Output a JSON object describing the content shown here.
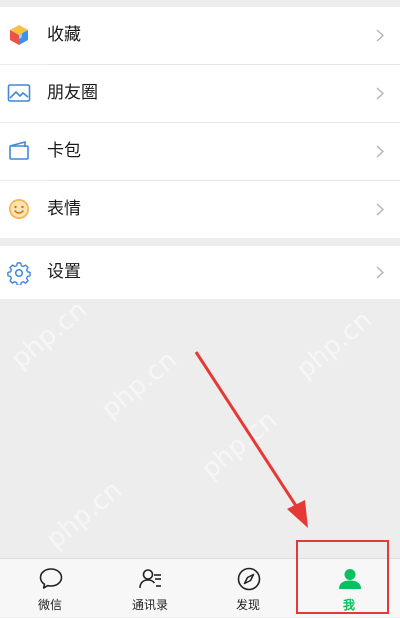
{
  "menu": [
    {
      "label": "收藏",
      "icon": "favorites-cube-icon"
    },
    {
      "label": "朋友圈",
      "icon": "moments-image-icon"
    },
    {
      "label": "卡包",
      "icon": "card-wallet-icon"
    },
    {
      "label": "表情",
      "icon": "smiley-face-icon"
    }
  ],
  "settings": {
    "label": "设置",
    "icon": "gear-icon"
  },
  "watermark_text": "php.cn",
  "tabbar": {
    "tabs": [
      {
        "label": "微信",
        "icon": "chat-bubble-icon"
      },
      {
        "label": "通讯录",
        "icon": "contacts-icon"
      },
      {
        "label": "发现",
        "icon": "compass-icon"
      },
      {
        "label": "我",
        "icon": "person-icon",
        "active": true
      }
    ]
  },
  "colors": {
    "accent": "#07c160",
    "annotation": "#e53935",
    "background": "#ededed"
  }
}
